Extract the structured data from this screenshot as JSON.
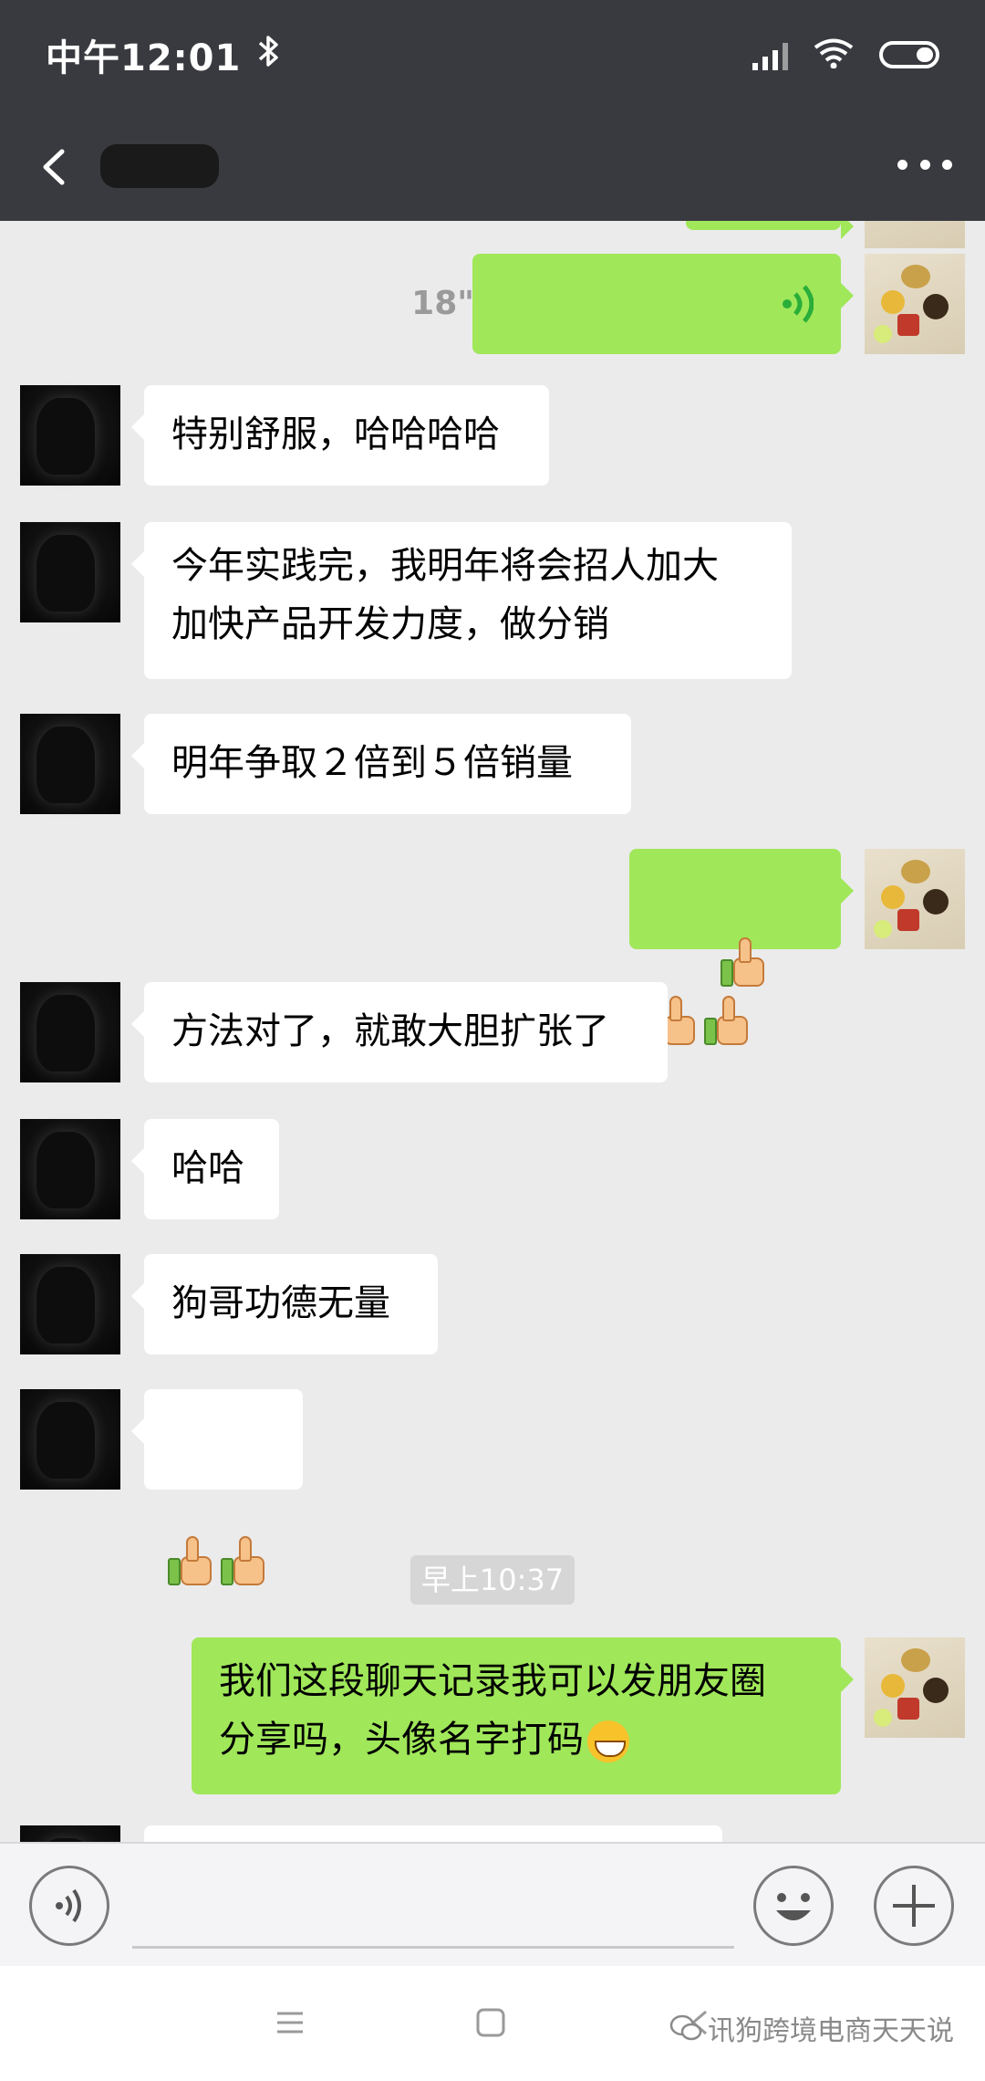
{
  "status_bar": {
    "time": "中午12:01",
    "bluetooth_icon": "bluetooth-icon",
    "signal_icon": "signal-icon",
    "wifi_icon": "wifi-icon",
    "battery_icon": "battery-icon"
  },
  "header": {
    "title": "",
    "back_icon": "chevron-left-icon",
    "more_icon": "more-dots-icon",
    "background": "#393a3f"
  },
  "messages": [
    {
      "from": "me",
      "type": "voice",
      "duration": "18\""
    },
    {
      "from": "other",
      "type": "text",
      "text": "特别舒服，哈哈哈哈"
    },
    {
      "from": "other",
      "type": "text",
      "text": "今年实践完，我明年将会招人加大\n加快产品开发力度，做分销"
    },
    {
      "from": "other",
      "type": "text",
      "text": "明年争取２倍到５倍销量"
    },
    {
      "from": "me",
      "type": "emoji",
      "emoji": "thumbs-up",
      "count": 3
    },
    {
      "from": "other",
      "type": "text",
      "text": "方法对了，就敢大胆扩张了"
    },
    {
      "from": "other",
      "type": "text",
      "text": "哈哈"
    },
    {
      "from": "other",
      "type": "text",
      "text": "狗哥功德无量"
    },
    {
      "from": "other",
      "type": "emoji",
      "emoji": "thumbs-up",
      "count": 2
    },
    {
      "from": "me",
      "type": "text",
      "text": "我们这段聊天记录我可以发朋友圈\n分享吗，头像名字打码",
      "trailing_emoji": "grin"
    }
  ],
  "timestamp_divider": "早上10:37",
  "input_bar": {
    "voice_icon": "voice-mode-icon",
    "emoji_icon": "emoji-face-icon",
    "plus_icon": "plus-icon"
  },
  "nav_bar": {
    "menu_icon": "menu-icon",
    "home_icon": "home-square-icon",
    "back_icon": "back-arrow-icon"
  },
  "watermark": "讯狗跨境电商天天说",
  "colors": {
    "my_bubble": "#a0e75a",
    "other_bubble": "#ffffff",
    "chat_bg": "#ebebeb",
    "voice_wave": "#2aae3a"
  }
}
